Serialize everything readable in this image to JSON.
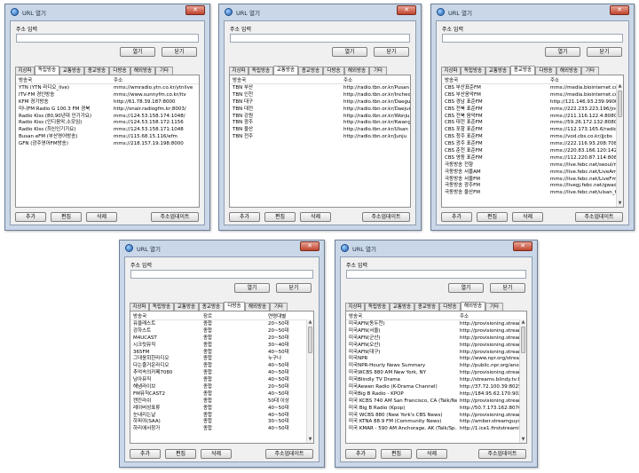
{
  "title": "URL 열기",
  "address_label": "주소 입력",
  "btn_open": "열기",
  "btn_close": "닫기",
  "btn_add": "추가",
  "btn_edit": "편집",
  "btn_delete": "삭제",
  "btn_update": "주소업데이트",
  "tabs": [
    "지상파",
    "독립방송",
    "교통방송",
    "종교방송",
    "다방송",
    "해외방송",
    "기타"
  ],
  "col_station": "방송국",
  "col_address": "주소",
  "col_genre": "장르",
  "col_age": "연령대별",
  "win1": {
    "rows": [
      {
        "name": "YTN (YTN 라디오_live)",
        "addr": "mms://wmradio.ytn.co.kr/ytnlive"
      },
      {
        "name": "ITV-FM 경인방송",
        "addr": "mms://www.sunnyfm.co.kr/itv"
      },
      {
        "name": "KFM 경기방송",
        "addr": "http://61.78.39.187:8000"
      },
      {
        "name": "미니FM Radio G 100.3 FM 경북",
        "addr": "http://onair.radiogfm.kr:8003/"
      },
      {
        "name": "Radio Kiss (80,90년대 인기가요)",
        "addr": "mms://124.53.158.174:1048/"
      },
      {
        "name": "Radio Kiss (인디음악,소모임)",
        "addr": "mms://124.53.158.172:1156"
      },
      {
        "name": "Radio Kiss (최신인기가요)",
        "addr": "mms://124.53.158.171:1048"
      },
      {
        "name": "Busan eFM (부산영어방송)",
        "addr": "mms://115.68.15.116/efm"
      },
      {
        "name": "GFN (광주영어FM방송)",
        "addr": "mms://218.157.19.198:8000"
      }
    ]
  },
  "win2": {
    "rows": [
      {
        "name": "TBN 부산",
        "addr": "http://radio.tbn.or.kr/Pusan"
      },
      {
        "name": "TBN 인천",
        "addr": "http://radio.tbn.or.kr/Incheon"
      },
      {
        "name": "TBN 대구",
        "addr": "http://radio.tbn.or.kr/Daegu"
      },
      {
        "name": "TBN 대전",
        "addr": "http://radio.tbn.or.kr/Daejun"
      },
      {
        "name": "TBN 강원",
        "addr": "http://radio.tbn.or.kr/Wonju"
      },
      {
        "name": "TBN 광주",
        "addr": "http://radio.tbn.or.kr/Kwangju"
      },
      {
        "name": "TBN 울산",
        "addr": "http://radio.tbn.or.kr/Ulsan"
      },
      {
        "name": "TBN 전주",
        "addr": "http://radio.tbn.or.kr/Junju"
      }
    ]
  },
  "win3": {
    "rows": [
      {
        "name": "CBS 부산표준FM",
        "addr": "mms://media.biointernet.co"
      },
      {
        "name": "CBS 부산음악FM",
        "addr": "mms://media.biointernet.co"
      },
      {
        "name": "CBS 경남 표준FM",
        "addr": "http://121.146.93.239:9900"
      },
      {
        "name": "CBS 전북 표준FM",
        "addr": "mms://222.233.223.196/jndb"
      },
      {
        "name": "CBS 전북 음악FM",
        "addr": "mms://211.116.122.4:8080"
      },
      {
        "name": "CBS 대전 표준FM",
        "addr": "mms://59.26.172.132:8080"
      },
      {
        "name": "CBS 포항 표준FM",
        "addr": "mms://112.173.165.6/radio"
      },
      {
        "name": "CBS 청주 표준FM",
        "addr": "mms://vod.cbs.co.kr/jjcbs"
      },
      {
        "name": "CBS 광주 표준FM",
        "addr": "mms://222.116.93.208:7080"
      },
      {
        "name": "CBS 춘천 표준FM",
        "addr": "mms://220.83.166.120:1422"
      },
      {
        "name": "CBS 영동 표준FM",
        "addr": "mms://112.220.87.114:8080"
      },
      {
        "name": "극동방송 전향",
        "addr": "mms://live.febc.net/seoul/m"
      },
      {
        "name": "극동방송 서울AM",
        "addr": "mms://live.febc.net/LiveAm"
      },
      {
        "name": "극동방송 서울FM",
        "addr": "mms://live.febc.net/LiveFm"
      },
      {
        "name": "극동방송 광주FM",
        "addr": "mms://livegj.febc.net/gwadi"
      },
      {
        "name": "극동방송 울산FM",
        "addr": "mms://live.febc.net/ulsan_fe"
      }
    ]
  },
  "win4": {
    "rows": [
      {
        "name": "유클래스트",
        "genre": "종합",
        "age": "20~50대"
      },
      {
        "name": "강하스트",
        "genre": "종합",
        "age": "20~50대"
      },
      {
        "name": "M4UCAST",
        "genre": "종합",
        "age": "20~50대"
      },
      {
        "name": "시크릿뮤직",
        "genre": "종합",
        "age": "30~40대"
      },
      {
        "name": "365FM",
        "genre": "종합",
        "age": "40~50대"
      },
      {
        "name": "그대윤회한라디오",
        "genre": "종합",
        "age": "누구나"
      },
      {
        "name": "다는즐거운라디오",
        "genre": "종합",
        "age": "40~50대"
      },
      {
        "name": "추억속의카페7080",
        "genre": "종합",
        "age": "40~50대"
      },
      {
        "name": "남아뮤직",
        "genre": "종합",
        "age": "40~50대"
      },
      {
        "name": "해냄라이브",
        "genre": "종합",
        "age": "20~50대"
      },
      {
        "name": "FM뮤직CAST2",
        "genre": "종합",
        "age": "40~50대"
      },
      {
        "name": "캔칸라쉬",
        "genre": "종합",
        "age": "50대 이상"
      },
      {
        "name": "레이버성표류",
        "genre": "종합",
        "age": "40~50대"
      },
      {
        "name": "눈내리는날",
        "genre": "종합",
        "age": "40~50대"
      },
      {
        "name": "하피야(SAA)",
        "genre": "종합",
        "age": "30~50대"
      },
      {
        "name": "하리에서창가",
        "genre": "종합",
        "age": "40~50대"
      }
    ]
  },
  "win5": {
    "rows": [
      {
        "name": "미국AFN(동두천)",
        "addr": "http://provisioning.streamt"
      },
      {
        "name": "미국AFN(서울)",
        "addr": "http://provisioning.streamt"
      },
      {
        "name": "미국AFN(군산)",
        "addr": "http://provisioning.streamt"
      },
      {
        "name": "미국AFN(오산)",
        "addr": "http://provisioning.streamt"
      },
      {
        "name": "미국AFN(대구)",
        "addr": "http://provisioning.streamt"
      },
      {
        "name": "미국NPR",
        "addr": "http://www.npr.org/streams"
      },
      {
        "name": "미국NPR-Hourly News Summary",
        "addr": "http://public.npr.org/anon."
      },
      {
        "name": "미국WCBS 880 AM New York, NY",
        "addr": "http://provisioning.streamt"
      },
      {
        "name": "미국Blindly TV Drama",
        "addr": "http://streams.blindy.tv:800"
      },
      {
        "name": "미국Aewen Radio (K-Drama Channel)",
        "addr": "http://37.72.100.39:8025/"
      },
      {
        "name": "미국Big B Radio - KPOP",
        "addr": "http://184.95.62.170:9026/"
      },
      {
        "name": "미국 KCBS 740 AM San Francisco, CA (Talk/Ne...",
        "addr": "http://provisioning.streamt"
      },
      {
        "name": "미국 Big B Radio (Kpop)",
        "addr": "http://50.7.173.162:8076"
      },
      {
        "name": "미국 WCBS 880 (New York's CBS News)",
        "addr": "http://provisioning.streamt"
      },
      {
        "name": "미국 KTNA 88.9 FM (Community News)",
        "addr": "http://amber.streamguys."
      },
      {
        "name": "미국 KMAR - 590 AM Anchorage, AK (Talk/Sp...",
        "addr": "http://1.ice1.firststreamin"
      }
    ]
  }
}
